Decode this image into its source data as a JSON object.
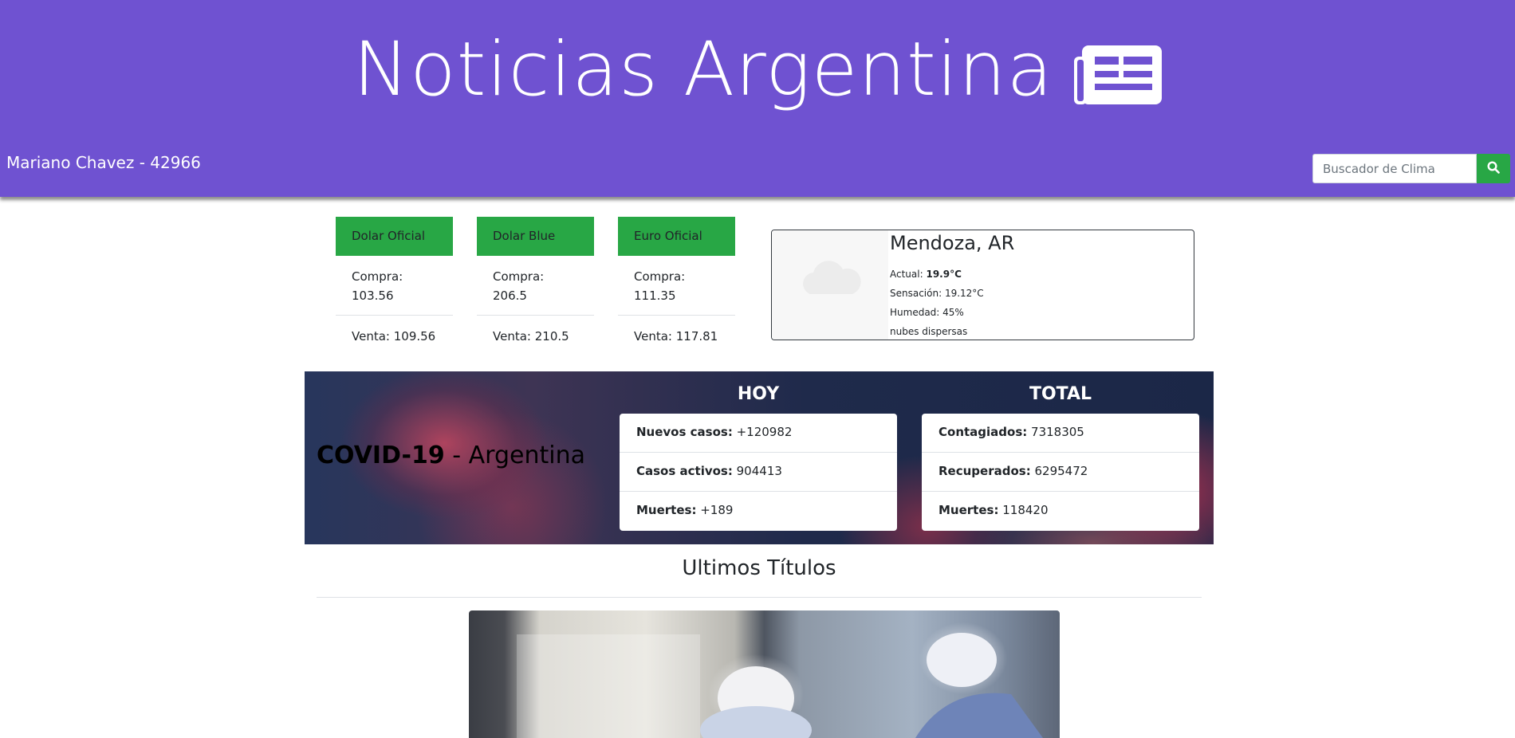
{
  "header": {
    "title": "Noticias Argentina",
    "title_icon": "newspaper-icon",
    "author": "Mariano Chavez - 42966",
    "search": {
      "placeholder": "Buscador de Clima",
      "button_icon": "search-icon"
    },
    "brand_color": "#6f52d1",
    "accent_color": "#28a745"
  },
  "currencies": [
    {
      "name": "Dolar Oficial",
      "compra": "Compra: 103.56",
      "venta": "Venta: 109.56"
    },
    {
      "name": "Dolar Blue",
      "compra": "Compra: 206.5",
      "venta": "Venta: 210.5"
    },
    {
      "name": "Euro Oficial",
      "compra": "Compra: 111.35",
      "venta": "Venta: 117.81"
    }
  ],
  "weather": {
    "city": "Mendoza, AR",
    "actual_label": "Actual:",
    "actual_value": "19.9°C",
    "sensacion": "Sensación: 19.12°C",
    "humedad": "Humedad: 45%",
    "description": "nubes dispersas",
    "icon": "cloud-icon"
  },
  "covid": {
    "title_bold": "COVID-19",
    "title_rest": " - Argentina",
    "hoy": {
      "header": "HOY",
      "rows": [
        {
          "label": "Nuevos casos:",
          "value": "+120982"
        },
        {
          "label": "Casos activos:",
          "value": "904413"
        },
        {
          "label": "Muertes:",
          "value": "+189"
        }
      ]
    },
    "total": {
      "header": "TOTAL",
      "rows": [
        {
          "label": "Contagiados:",
          "value": "7318305"
        },
        {
          "label": "Recuperados:",
          "value": "6295472"
        },
        {
          "label": "Muertes:",
          "value": "118420"
        }
      ]
    }
  },
  "news": {
    "section_title": "Ultimos Títulos"
  }
}
